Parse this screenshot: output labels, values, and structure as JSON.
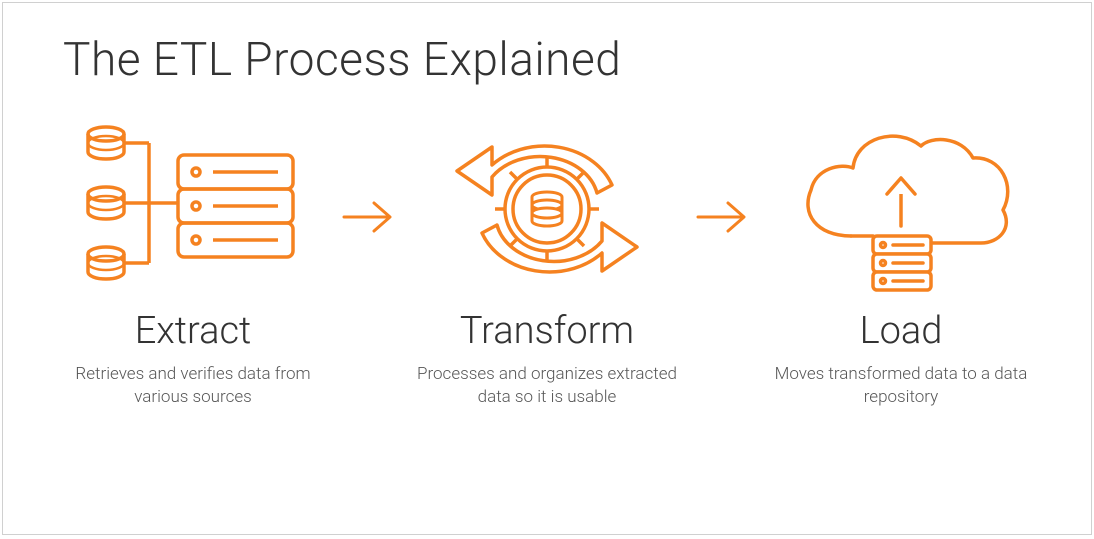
{
  "title": "The ETL Process Explained",
  "accent_color": "#f58220",
  "steps": [
    {
      "key": "extract",
      "title": "Extract",
      "description": "Retrieves and verifies data from various sources",
      "icon": "extract-sources-icon"
    },
    {
      "key": "transform",
      "title": "Transform",
      "description": "Processes and organizes extracted data so it is usable",
      "icon": "transform-gear-icon"
    },
    {
      "key": "load",
      "title": "Load",
      "description": "Moves transformed data to a data repository",
      "icon": "load-cloud-icon"
    }
  ]
}
